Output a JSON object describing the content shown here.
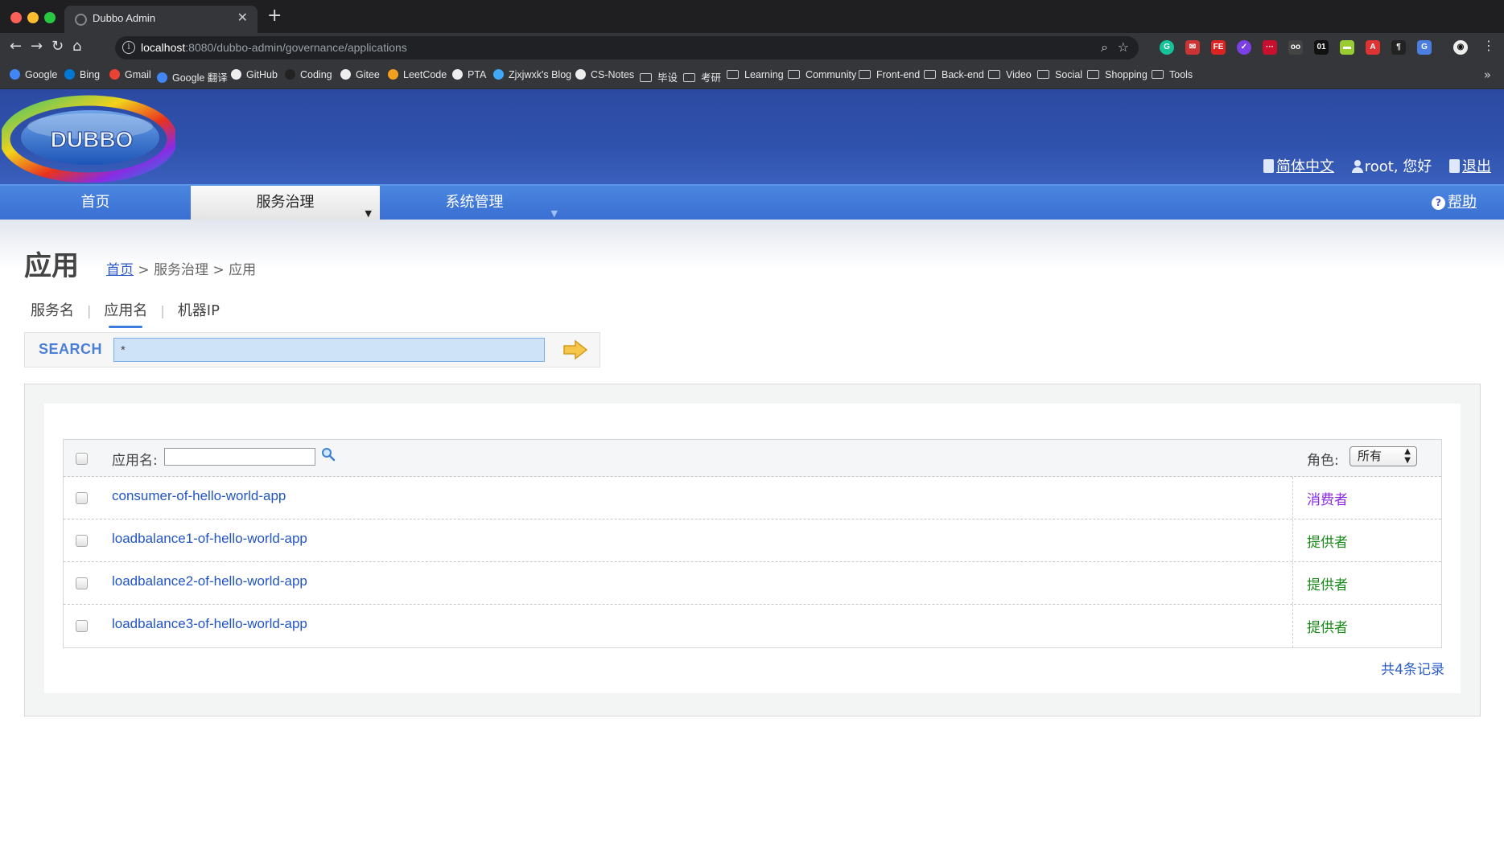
{
  "browser": {
    "tab_title": "Dubbo Admin",
    "tab_close": "✕",
    "new_tab": "+",
    "url_host": "localhost",
    "url_rest": ":8080/dubbo-admin/governance/applications",
    "bookmarks": [
      {
        "label": "Google",
        "type": "site",
        "color": "#4285f4"
      },
      {
        "label": "Bing",
        "type": "site",
        "color": "#0078d4"
      },
      {
        "label": "Gmail",
        "type": "site",
        "color": "#ea4335"
      },
      {
        "label": "Google 翻译",
        "type": "site",
        "color": "#4285f4"
      },
      {
        "label": "GitHub",
        "type": "site",
        "color": "#eeeeee"
      },
      {
        "label": "Coding",
        "type": "site",
        "color": "#222222"
      },
      {
        "label": "Gitee",
        "type": "site",
        "color": "#eeeeee"
      },
      {
        "label": "LeetCode",
        "type": "site",
        "color": "#f0a020"
      },
      {
        "label": "PTA",
        "type": "site",
        "color": "#eeeeee"
      },
      {
        "label": "Zjxjwxk's Blog",
        "type": "site",
        "color": "#3fa9f5"
      },
      {
        "label": "CS-Notes",
        "type": "site",
        "color": "#eeeeee"
      },
      {
        "label": "毕设",
        "type": "folder"
      },
      {
        "label": "考研",
        "type": "folder"
      },
      {
        "label": "Learning",
        "type": "folder"
      },
      {
        "label": "Community",
        "type": "folder"
      },
      {
        "label": "Front-end",
        "type": "folder"
      },
      {
        "label": "Back-end",
        "type": "folder"
      },
      {
        "label": "Video",
        "type": "folder"
      },
      {
        "label": "Social",
        "type": "folder"
      },
      {
        "label": "Shopping",
        "type": "folder"
      },
      {
        "label": "Tools",
        "type": "folder"
      }
    ],
    "bookmarks_more": "»"
  },
  "header": {
    "logo_text": "DUBBO",
    "language": "简体中文",
    "greeting": "root, 您好",
    "logout": "退出"
  },
  "nav": {
    "items": [
      {
        "label": "首页"
      },
      {
        "label": "服务治理"
      },
      {
        "label": "系统管理"
      }
    ],
    "help": "帮助"
  },
  "page": {
    "title": "应用",
    "breadcrumb": {
      "home": "首页",
      "sep1": " > ",
      "section": "服务治理",
      "sep2": " > ",
      "current": "应用"
    }
  },
  "search": {
    "tabs": [
      "服务名",
      "应用名",
      "机器IP"
    ],
    "active_tab": "应用名",
    "label": "SEARCH",
    "value": "*"
  },
  "table": {
    "header": {
      "name_label": "应用名:",
      "role_label": "角色:",
      "role_selected": "所有"
    },
    "rows": [
      {
        "name": "consumer-of-hello-world-app",
        "role": "消费者",
        "role_color": "#8a2be2"
      },
      {
        "name": "loadbalance1-of-hello-world-app",
        "role": "提供者",
        "role_color": "#1a8a1a"
      },
      {
        "name": "loadbalance2-of-hello-world-app",
        "role": "提供者",
        "role_color": "#1a8a1a"
      },
      {
        "name": "loadbalance3-of-hello-world-app",
        "role": "提供者",
        "role_color": "#1a8a1a"
      }
    ],
    "records": "共4条记录"
  },
  "colors": {
    "header_blue": "#2f52ad",
    "nav_blue": "#3a6fd1",
    "link_blue": "#2255c4",
    "consumer": "#8a2be2",
    "provider": "#1a8a1a"
  }
}
